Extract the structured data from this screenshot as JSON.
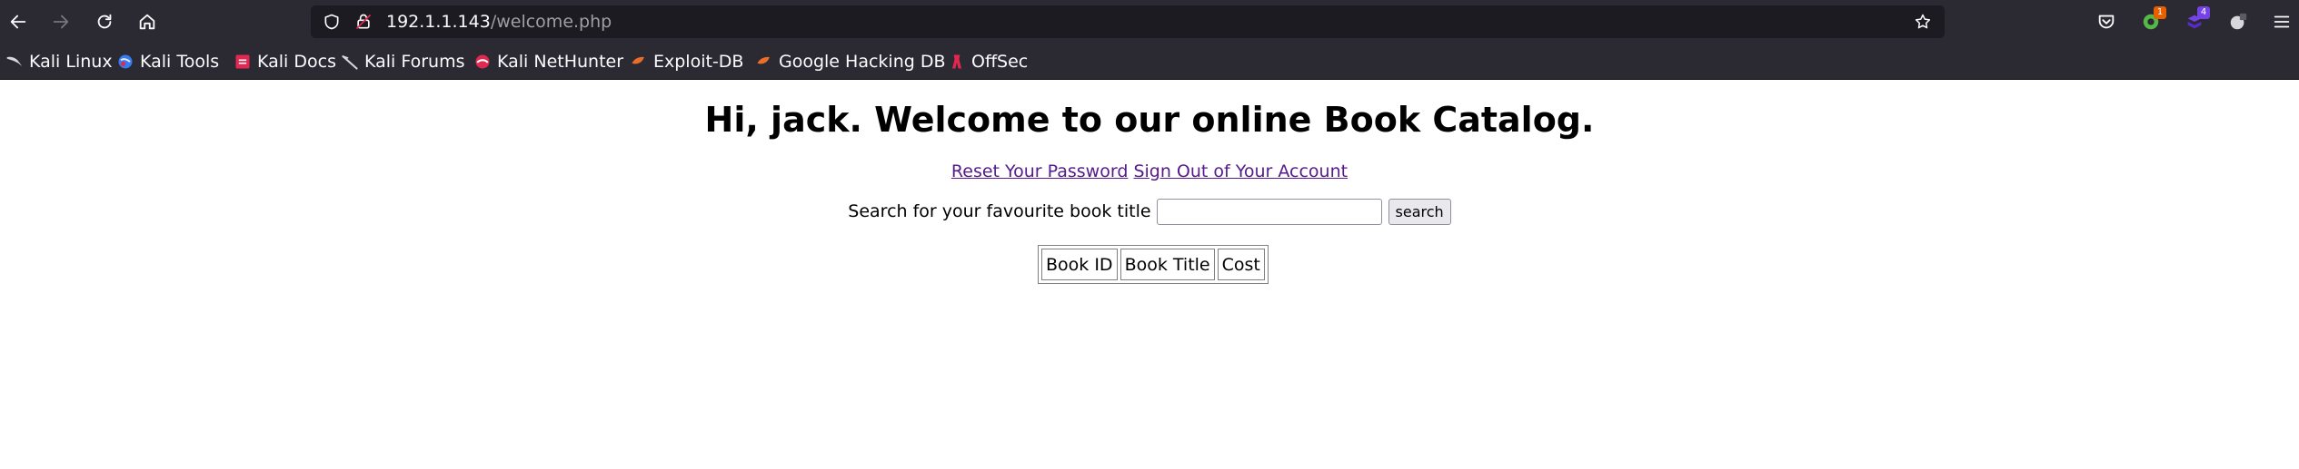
{
  "browser": {
    "address_host": "192.1.1.143",
    "address_path": "/welcome.php",
    "icons": {
      "back": "back-arrow-icon",
      "forward": "forward-arrow-icon",
      "reload": "reload-icon",
      "home": "home-icon",
      "tracking": "shield-icon",
      "insecure": "insecure-lock-icon",
      "bookmark": "star-icon",
      "pocket": "pocket-icon",
      "menu": "hamburger-menu-icon"
    },
    "extensions": [
      {
        "name": "extension-1",
        "badge": "1",
        "badge_color": "#e66000"
      },
      {
        "name": "extension-2",
        "badge": "4",
        "badge_color": "#7542e5"
      },
      {
        "name": "extension-3",
        "badge": "",
        "badge_color": "#5b5b66"
      }
    ]
  },
  "bookmarks": [
    {
      "label": "Kali Linux",
      "icon": "kali-dragon-icon"
    },
    {
      "label": "Kali Tools",
      "icon": "kali-tools-icon"
    },
    {
      "label": "Kali Docs",
      "icon": "kali-docs-icon"
    },
    {
      "label": "Kali Forums",
      "icon": "kali-forums-icon"
    },
    {
      "label": "Kali NetHunter",
      "icon": "nethunter-icon"
    },
    {
      "label": "Exploit-DB",
      "icon": "exploit-db-icon"
    },
    {
      "label": "Google Hacking DB",
      "icon": "ghdb-icon"
    },
    {
      "label": "OffSec",
      "icon": "offsec-icon"
    }
  ],
  "page": {
    "heading": "Hi, jack. Welcome to our online Book Catalog.",
    "links": {
      "reset_password": "Reset Your Password",
      "sign_out": "Sign Out of Your Account"
    },
    "search": {
      "label": "Search for your favourite book title",
      "value": "",
      "button": "search"
    },
    "table": {
      "headers": [
        "Book ID",
        "Book Title",
        "Cost"
      ]
    }
  }
}
